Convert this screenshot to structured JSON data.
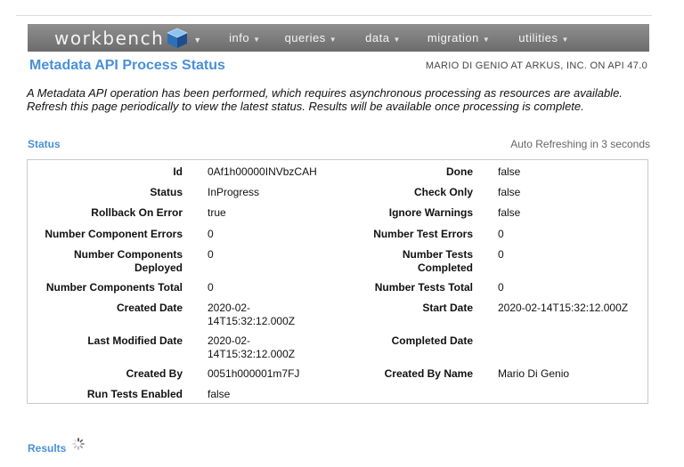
{
  "nav": {
    "brand": "workbench",
    "menus": [
      {
        "label": "info"
      },
      {
        "label": "queries"
      },
      {
        "label": "data"
      },
      {
        "label": "migration"
      },
      {
        "label": "utilities"
      }
    ]
  },
  "header": {
    "title": "Metadata API Process Status",
    "api_info": "MARIO DI GENIO AT ARKUS, INC. ON API 47.0"
  },
  "intro": "A Metadata API operation has been performed, which requires asynchronous processing as resources are available. Refresh this page periodically to view the latest status. Results will be available once processing is complete.",
  "status": {
    "label": "Status",
    "refresh": "Auto Refreshing in 3 seconds",
    "rows": [
      {
        "l1": "Id",
        "v1": "0Af1h00000INVbzCAH",
        "l2": "Done",
        "v2": "false"
      },
      {
        "l1": "Status",
        "v1": "InProgress",
        "l2": "Check Only",
        "v2": "false"
      },
      {
        "l1": "Rollback On Error",
        "v1": "true",
        "l2": "Ignore Warnings",
        "v2": "false"
      },
      {
        "l1": "Number Component Errors",
        "v1": "0",
        "l2": "Number Test Errors",
        "v2": "0"
      },
      {
        "l1": "Number Components Deployed",
        "v1": "0",
        "l2": "Number Tests Completed",
        "v2": "0"
      },
      {
        "l1": "Number Components Total",
        "v1": "0",
        "l2": "Number Tests Total",
        "v2": "0"
      },
      {
        "l1": "Created Date",
        "v1": "2020-02-14T15:32:12.000Z",
        "l2": "Start Date",
        "v2": "2020-02-14T15:32:12.000Z"
      },
      {
        "l1": "Last Modified Date",
        "v1": "2020-02-14T15:32:12.000Z",
        "l2": "Completed Date",
        "v2": ""
      },
      {
        "l1": "Created By",
        "v1": "0051h000001m7FJ",
        "l2": "Created By Name",
        "v2": "Mario Di Genio"
      },
      {
        "l1": "Run Tests Enabled",
        "v1": "false",
        "l2": "",
        "v2": ""
      }
    ]
  },
  "results": {
    "label": "Results"
  },
  "colors": {
    "accent": "#4a90d9",
    "navbar": "#7d7d7d"
  }
}
